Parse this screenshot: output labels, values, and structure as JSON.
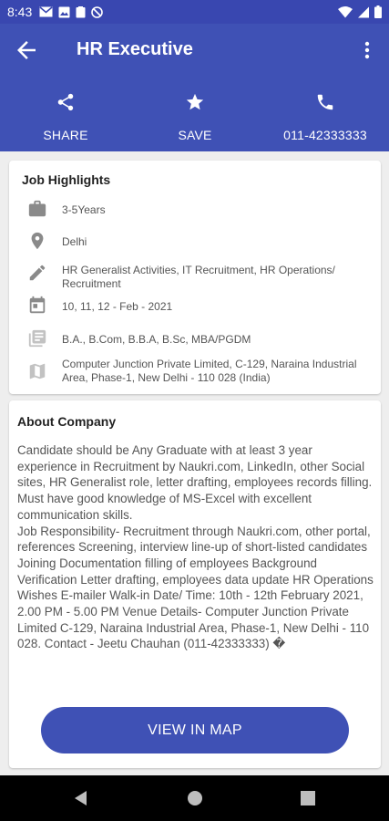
{
  "status_bar": {
    "time": "8:43"
  },
  "app_bar": {
    "title": "HR Executive",
    "actions": [
      {
        "label": "SHARE",
        "icon": "share-icon"
      },
      {
        "label": "SAVE",
        "icon": "star-icon"
      },
      {
        "label": "011-42333333",
        "icon": "phone-icon"
      }
    ]
  },
  "highlights": {
    "heading": "Job Highlights",
    "items": [
      {
        "icon": "briefcase-icon",
        "text": "3-5Years"
      },
      {
        "icon": "location-pin-icon",
        "text": "Delhi"
      },
      {
        "icon": "pencil-icon",
        "text": "HR Generalist Activities, IT Recruitment, HR Operations/ Recruitment"
      },
      {
        "icon": "calendar-icon",
        "text": "10, 11, 12 - Feb - 2021"
      },
      {
        "icon": "education-icon",
        "text": "B.A., B.Com, B.B.A, B.Sc, MBA/PGDM"
      },
      {
        "icon": "map-icon",
        "text": "Computer Junction Private Limited, C-129, Naraina Industrial Area, Phase-1, New Delhi - 110 028 (India)"
      }
    ]
  },
  "about": {
    "heading": "About Company",
    "body": "Candidate should be Any Graduate with at least 3 year experience in Recruitment by Naukri.com, LinkedIn, other Social sites, HR Generalist role, letter drafting, employees records filling. Must have good knowledge of MS-Excel with excellent communication skills.\nJob Responsibility- Recruitment through Naukri.com, other portal, references Screening, interview line-up of short-listed candidates Joining Documentation filling of employees Background Verification Letter drafting, employees data update HR Operations Wishes E-mailer Walk-in Date/ Time: 10th - 12th February 2021, 2.00 PM - 5.00 PM Venue Details- Computer Junction Private Limited C-129, Naraina Industrial Area, Phase-1, New Delhi - 110 028. Contact - Jeetu Chauhan (011-42333333) �",
    "map_button": "VIEW IN MAP"
  },
  "colors": {
    "primary": "#3f51b5",
    "status_bar": "#3947b0",
    "icon_grey": "#8a8a8a"
  }
}
